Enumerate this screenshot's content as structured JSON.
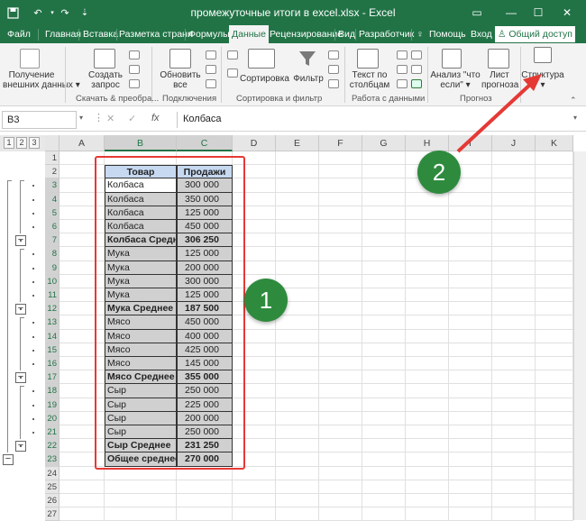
{
  "window": {
    "title": "промежуточные итоги в excel.xlsx - Excel",
    "accent_color": "#217346"
  },
  "tabs": [
    "Файл",
    "Главная",
    "Вставка",
    "Разметка страни",
    "Формулы",
    "Данные",
    "Рецензирование",
    "Вид",
    "Разработчик"
  ],
  "help_label": "Помощь",
  "signin_label": "Вход",
  "share_label": "Общий доступ",
  "ribbon": {
    "get_data": [
      "Получение",
      "внешних данных"
    ],
    "create_query": [
      "Создать",
      "запрос"
    ],
    "group_query_label": "Скачать & преобра...",
    "refresh_all": [
      "Обновить",
      "все"
    ],
    "group_connections_label": "Подключения",
    "sort": "Сортировка",
    "filter": "Фильтр",
    "group_sort_label": "Сортировка и фильтр",
    "text_to_columns": [
      "Текст по",
      "столбцам"
    ],
    "group_tools_label": "Работа с данными",
    "whatif": [
      "Анализ \"что",
      "если\""
    ],
    "forecast_sheet": [
      "Лист",
      "прогноза"
    ],
    "group_forecast_label": "Прогноз",
    "outline": "Структура"
  },
  "formula_bar": {
    "name_box": "B3",
    "fx": "fx",
    "content": "Колбаса"
  },
  "outline_levels": [
    "1",
    "2",
    "3"
  ],
  "columns": [
    "A",
    "B",
    "C",
    "D",
    "E",
    "F",
    "G",
    "H",
    "I",
    "J",
    "K"
  ],
  "rows": [
    "1",
    "2",
    "3",
    "4",
    "5",
    "6",
    "7",
    "8",
    "9",
    "10",
    "11",
    "12",
    "13",
    "14",
    "15",
    "16",
    "17",
    "18",
    "19",
    "20",
    "21",
    "22",
    "23",
    "24",
    "25",
    "26",
    "27"
  ],
  "table": {
    "headers": [
      "Товар",
      "Продажи"
    ],
    "rows": [
      {
        "item": "Колбаса",
        "value": "300 000",
        "bold": false
      },
      {
        "item": "Колбаса",
        "value": "350 000",
        "bold": false
      },
      {
        "item": "Колбаса",
        "value": "125 000",
        "bold": false
      },
      {
        "item": "Колбаса",
        "value": "450 000",
        "bold": false
      },
      {
        "item": "Колбаса Среднее",
        "value": "306 250",
        "bold": true
      },
      {
        "item": "Мука",
        "value": "125 000",
        "bold": false
      },
      {
        "item": "Мука",
        "value": "200 000",
        "bold": false
      },
      {
        "item": "Мука",
        "value": "300 000",
        "bold": false
      },
      {
        "item": "Мука",
        "value": "125 000",
        "bold": false
      },
      {
        "item": "Мука Среднее",
        "value": "187 500",
        "bold": true
      },
      {
        "item": "Мясо",
        "value": "450 000",
        "bold": false
      },
      {
        "item": "Мясо",
        "value": "400 000",
        "bold": false
      },
      {
        "item": "Мясо",
        "value": "425 000",
        "bold": false
      },
      {
        "item": "Мясо",
        "value": "145 000",
        "bold": false
      },
      {
        "item": "Мясо Среднее",
        "value": "355 000",
        "bold": true
      },
      {
        "item": "Сыр",
        "value": "250 000",
        "bold": false
      },
      {
        "item": "Сыр",
        "value": "225 000",
        "bold": false
      },
      {
        "item": "Сыр",
        "value": "200 000",
        "bold": false
      },
      {
        "item": "Сыр",
        "value": "250 000",
        "bold": false
      },
      {
        "item": "Сыр Среднее",
        "value": "231 250",
        "bold": true
      },
      {
        "item": "Общее среднее",
        "value": "270 000",
        "bold": true
      }
    ]
  },
  "callouts": {
    "one": "1",
    "two": "2",
    "color": "#e53935",
    "badge_color": "#2e8b3e"
  }
}
